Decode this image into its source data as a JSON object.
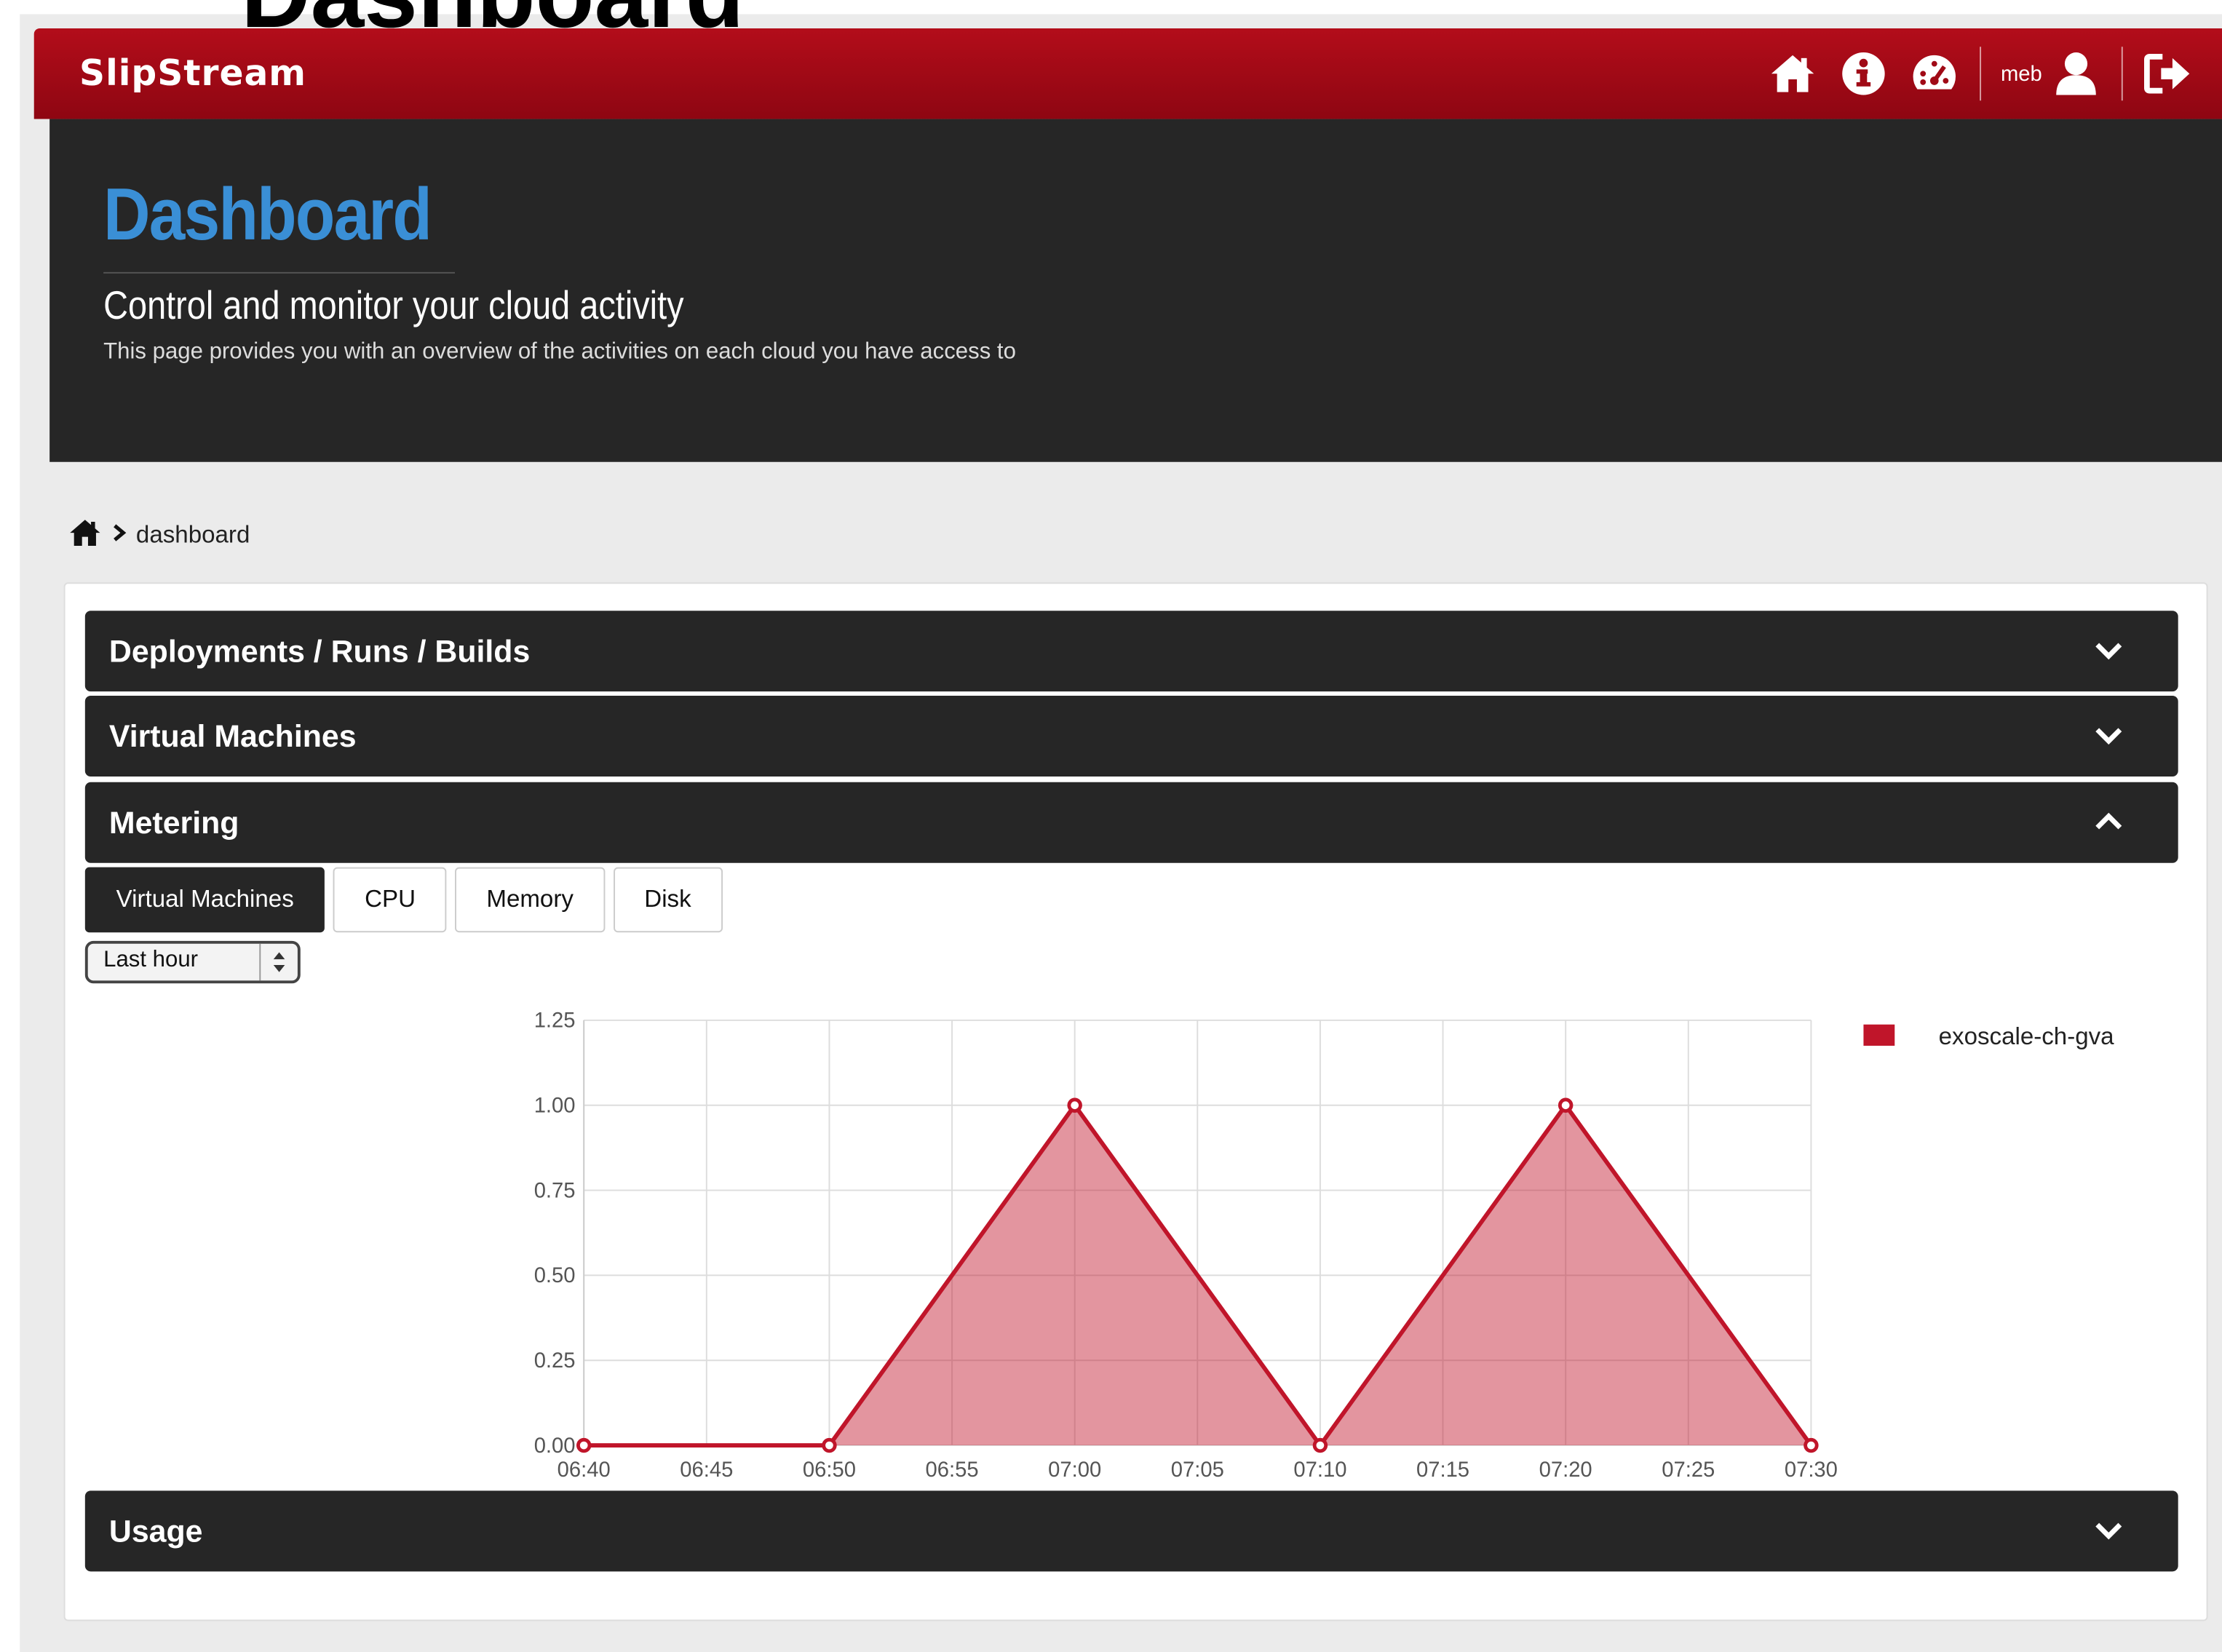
{
  "page_heading_ghost": "Dashboard",
  "navbar": {
    "brand": "SlipStream",
    "username": "meb",
    "icons": [
      "home-icon",
      "info-icon",
      "dashboard-icon",
      "user-icon",
      "logout-icon"
    ]
  },
  "header": {
    "title": "Dashboard",
    "subtitle": "Control and monitor your cloud activity",
    "description": "This page provides you with an overview of the activities on each cloud you have access to"
  },
  "breadcrumb": {
    "current": "dashboard"
  },
  "sections": {
    "deployments": "Deployments / Runs / Builds",
    "virtual_machines": "Virtual Machines",
    "metering": "Metering",
    "usage": "Usage"
  },
  "metering": {
    "tabs": [
      "Virtual Machines",
      "CPU",
      "Memory",
      "Disk"
    ],
    "active_tab": "Virtual Machines",
    "period_select": "Last hour"
  },
  "colors": {
    "navbar": "#a00a16",
    "accent_blue": "#3a8fd6",
    "series": "#c0152a",
    "dark_panel": "#262626"
  },
  "chart_data": {
    "type": "area",
    "x": [
      "06:40",
      "06:50",
      "07:00",
      "07:10",
      "07:20",
      "07:30"
    ],
    "x_ticks": [
      "06:40",
      "06:45",
      "06:50",
      "06:55",
      "07:00",
      "07:05",
      "07:10",
      "07:15",
      "07:20",
      "07:25",
      "07:30"
    ],
    "series": [
      {
        "name": "exoscale-ch-gva",
        "values": [
          0,
          0,
          1,
          0,
          1,
          0
        ]
      }
    ],
    "y_ticks": [
      "0.00",
      "0.25",
      "0.50",
      "0.75",
      "1.00",
      "1.25"
    ],
    "ylim": [
      0,
      1.25
    ],
    "grid": true,
    "legend": "top-right"
  }
}
